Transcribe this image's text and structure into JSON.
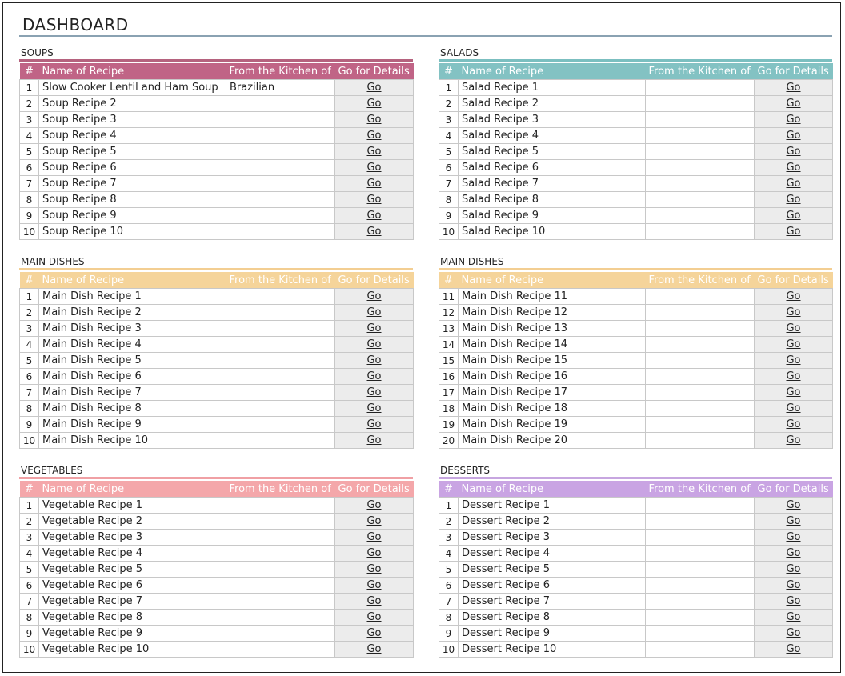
{
  "title": "DASHBOARD",
  "headers": {
    "num": "#",
    "name": "Name of Recipe",
    "kitchen": "From the Kitchen of",
    "go": "Go for Details"
  },
  "go_label": "Go",
  "colors": {
    "soups": "#c06486",
    "salads": "#83c2c3",
    "main_dishes": "#f5d49a",
    "vegetables": "#f4a7aa",
    "desserts": "#c9a4e3",
    "go_cell": "#ececec",
    "title_rule": "#8aa2b2"
  },
  "sections": [
    {
      "key": "soups",
      "title": "SOUPS",
      "rows": [
        {
          "num": "1",
          "name": "Slow Cooker Lentil and Ham Soup",
          "kitchen": "Brazilian"
        },
        {
          "num": "2",
          "name": "Soup Recipe 2",
          "kitchen": ""
        },
        {
          "num": "3",
          "name": "Soup Recipe 3",
          "kitchen": ""
        },
        {
          "num": "4",
          "name": "Soup Recipe 4",
          "kitchen": ""
        },
        {
          "num": "5",
          "name": "Soup Recipe 5",
          "kitchen": ""
        },
        {
          "num": "6",
          "name": "Soup Recipe 6",
          "kitchen": ""
        },
        {
          "num": "7",
          "name": "Soup Recipe 7",
          "kitchen": ""
        },
        {
          "num": "8",
          "name": "Soup Recipe 8",
          "kitchen": ""
        },
        {
          "num": "9",
          "name": "Soup Recipe 9",
          "kitchen": ""
        },
        {
          "num": "10",
          "name": "Soup Recipe 10",
          "kitchen": ""
        }
      ]
    },
    {
      "key": "salads",
      "title": "SALADS",
      "rows": [
        {
          "num": "1",
          "name": "Salad Recipe 1",
          "kitchen": ""
        },
        {
          "num": "2",
          "name": "Salad Recipe 2",
          "kitchen": ""
        },
        {
          "num": "3",
          "name": "Salad Recipe 3",
          "kitchen": ""
        },
        {
          "num": "4",
          "name": "Salad Recipe 4",
          "kitchen": ""
        },
        {
          "num": "5",
          "name": "Salad Recipe 5",
          "kitchen": ""
        },
        {
          "num": "6",
          "name": "Salad Recipe 6",
          "kitchen": ""
        },
        {
          "num": "7",
          "name": "Salad Recipe 7",
          "kitchen": ""
        },
        {
          "num": "8",
          "name": "Salad Recipe 8",
          "kitchen": ""
        },
        {
          "num": "9",
          "name": "Salad Recipe 9",
          "kitchen": ""
        },
        {
          "num": "10",
          "name": "Salad Recipe 10",
          "kitchen": ""
        }
      ]
    },
    {
      "key": "main_dishes_1",
      "title": "MAIN DISHES",
      "rows": [
        {
          "num": "1",
          "name": "Main Dish Recipe 1",
          "kitchen": ""
        },
        {
          "num": "2",
          "name": "Main Dish Recipe 2",
          "kitchen": ""
        },
        {
          "num": "3",
          "name": "Main Dish Recipe 3",
          "kitchen": ""
        },
        {
          "num": "4",
          "name": "Main Dish Recipe 4",
          "kitchen": ""
        },
        {
          "num": "5",
          "name": "Main Dish Recipe 5",
          "kitchen": ""
        },
        {
          "num": "6",
          "name": "Main Dish Recipe 6",
          "kitchen": ""
        },
        {
          "num": "7",
          "name": "Main Dish Recipe 7",
          "kitchen": ""
        },
        {
          "num": "8",
          "name": "Main Dish Recipe 8",
          "kitchen": ""
        },
        {
          "num": "9",
          "name": "Main Dish Recipe 9",
          "kitchen": ""
        },
        {
          "num": "10",
          "name": "Main Dish Recipe 10",
          "kitchen": ""
        }
      ]
    },
    {
      "key": "main_dishes_2",
      "title": "MAIN DISHES",
      "rows": [
        {
          "num": "11",
          "name": "Main Dish Recipe 11",
          "kitchen": ""
        },
        {
          "num": "12",
          "name": "Main Dish Recipe 12",
          "kitchen": ""
        },
        {
          "num": "13",
          "name": "Main Dish Recipe 13",
          "kitchen": ""
        },
        {
          "num": "14",
          "name": "Main Dish Recipe 14",
          "kitchen": ""
        },
        {
          "num": "15",
          "name": "Main Dish Recipe 15",
          "kitchen": ""
        },
        {
          "num": "16",
          "name": "Main Dish Recipe 16",
          "kitchen": ""
        },
        {
          "num": "17",
          "name": "Main Dish Recipe 17",
          "kitchen": ""
        },
        {
          "num": "18",
          "name": "Main Dish Recipe 18",
          "kitchen": ""
        },
        {
          "num": "19",
          "name": "Main Dish Recipe 19",
          "kitchen": ""
        },
        {
          "num": "20",
          "name": "Main Dish Recipe 20",
          "kitchen": ""
        }
      ]
    },
    {
      "key": "vegetables",
      "title": "VEGETABLES",
      "rows": [
        {
          "num": "1",
          "name": "Vegetable Recipe 1",
          "kitchen": ""
        },
        {
          "num": "2",
          "name": "Vegetable Recipe 2",
          "kitchen": ""
        },
        {
          "num": "3",
          "name": "Vegetable Recipe 3",
          "kitchen": ""
        },
        {
          "num": "4",
          "name": "Vegetable Recipe 4",
          "kitchen": ""
        },
        {
          "num": "5",
          "name": "Vegetable Recipe 5",
          "kitchen": ""
        },
        {
          "num": "6",
          "name": "Vegetable Recipe 6",
          "kitchen": ""
        },
        {
          "num": "7",
          "name": "Vegetable Recipe 7",
          "kitchen": ""
        },
        {
          "num": "8",
          "name": "Vegetable Recipe 8",
          "kitchen": ""
        },
        {
          "num": "9",
          "name": "Vegetable Recipe 9",
          "kitchen": ""
        },
        {
          "num": "10",
          "name": "Vegetable Recipe 10",
          "kitchen": ""
        }
      ]
    },
    {
      "key": "desserts",
      "title": "DESSERTS",
      "rows": [
        {
          "num": "1",
          "name": "Dessert Recipe 1",
          "kitchen": ""
        },
        {
          "num": "2",
          "name": "Dessert Recipe 2",
          "kitchen": ""
        },
        {
          "num": "3",
          "name": "Dessert Recipe 3",
          "kitchen": ""
        },
        {
          "num": "4",
          "name": "Dessert Recipe 4",
          "kitchen": ""
        },
        {
          "num": "5",
          "name": "Dessert Recipe 5",
          "kitchen": ""
        },
        {
          "num": "6",
          "name": "Dessert Recipe 6",
          "kitchen": ""
        },
        {
          "num": "7",
          "name": "Dessert Recipe 7",
          "kitchen": ""
        },
        {
          "num": "8",
          "name": "Dessert Recipe 8",
          "kitchen": ""
        },
        {
          "num": "9",
          "name": "Dessert Recipe 9",
          "kitchen": ""
        },
        {
          "num": "10",
          "name": "Dessert Recipe 10",
          "kitchen": ""
        }
      ]
    }
  ]
}
